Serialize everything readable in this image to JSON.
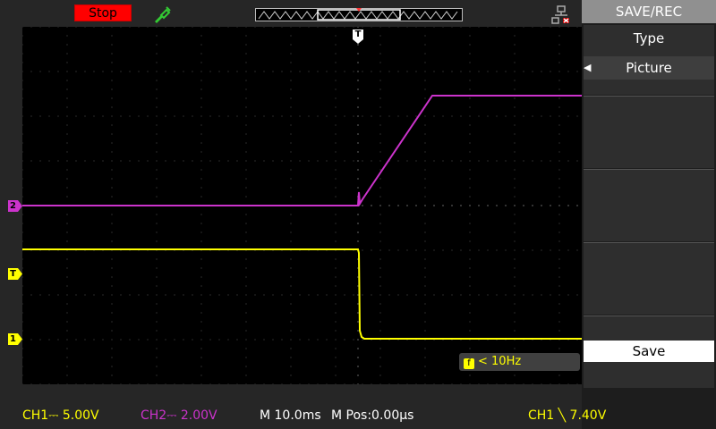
{
  "top": {
    "run_state": "Stop"
  },
  "waveform": {
    "ch1_color": "#ffff00",
    "ch2_color": "#cc33cc",
    "trigger_marker": "T",
    "ch1_marker": "1",
    "ch2_marker": "2",
    "trigger_level_marker": "T"
  },
  "frequency": {
    "icon": "f",
    "text": "< 10Hz"
  },
  "menu": {
    "title": "SAVE/REC",
    "type_label": "Type",
    "type_value": "Picture",
    "save_label": "Save"
  },
  "status": {
    "ch1": "CH1⎓ 5.00V",
    "ch2": "CH2⎓ 2.00V",
    "timebase": "M 10.0ms",
    "mpos": "M Pos:0.00µs",
    "trigger": "CH1 ╲ 7.40V"
  },
  "colors": {
    "stop_bg": "#ff0000",
    "status_ch1": "#ffff00",
    "status_ch2": "#cc33cc",
    "menu_title_bg": "#909090"
  }
}
